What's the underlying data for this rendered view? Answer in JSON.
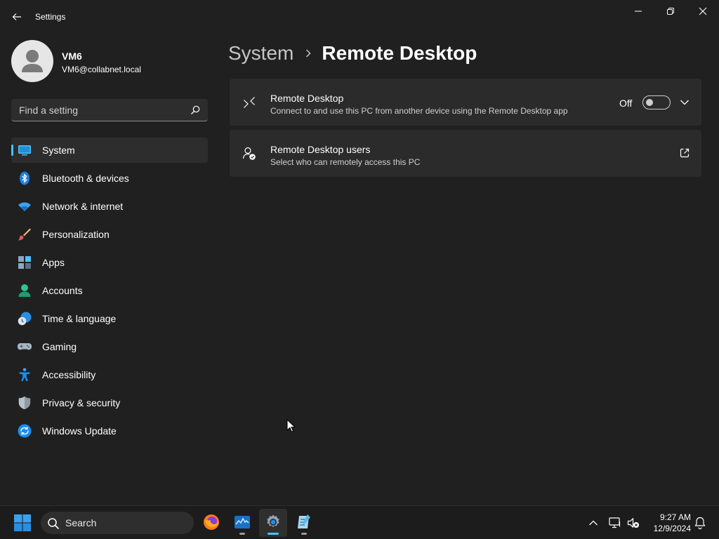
{
  "window": {
    "title": "Settings",
    "controls": {
      "minimize": "minimize-icon",
      "maximize": "restore-icon",
      "close": "close-icon"
    }
  },
  "profile": {
    "name": "VM6",
    "email": "VM6@collabnet.local"
  },
  "search": {
    "placeholder": "Find a setting"
  },
  "sidebar": {
    "items": [
      {
        "label": "System",
        "icon": "system-icon",
        "active": true
      },
      {
        "label": "Bluetooth & devices",
        "icon": "bluetooth-icon"
      },
      {
        "label": "Network & internet",
        "icon": "wifi-icon"
      },
      {
        "label": "Personalization",
        "icon": "brush-icon"
      },
      {
        "label": "Apps",
        "icon": "apps-icon"
      },
      {
        "label": "Accounts",
        "icon": "accounts-icon"
      },
      {
        "label": "Time & language",
        "icon": "time-language-icon"
      },
      {
        "label": "Gaming",
        "icon": "gamepad-icon"
      },
      {
        "label": "Accessibility",
        "icon": "accessibility-icon"
      },
      {
        "label": "Privacy & security",
        "icon": "shield-icon"
      },
      {
        "label": "Windows Update",
        "icon": "update-icon"
      }
    ]
  },
  "breadcrumb": {
    "parent": "System",
    "current": "Remote Desktop"
  },
  "cards": {
    "remote_desktop": {
      "title": "Remote Desktop",
      "description": "Connect to and use this PC from another device using the Remote Desktop app",
      "toggle_state": "Off"
    },
    "remote_users": {
      "title": "Remote Desktop users",
      "description": "Select who can remotely access this PC"
    }
  },
  "taskbar": {
    "search_label": "Search",
    "apps": [
      "firefox-icon",
      "task-manager-icon",
      "settings-icon",
      "notepad-icon"
    ],
    "time": "9:27 AM",
    "date": "12/9/2024"
  },
  "colors": {
    "background": "#202020",
    "card": "#2b2b2b",
    "accent": "#4cc2ff"
  }
}
